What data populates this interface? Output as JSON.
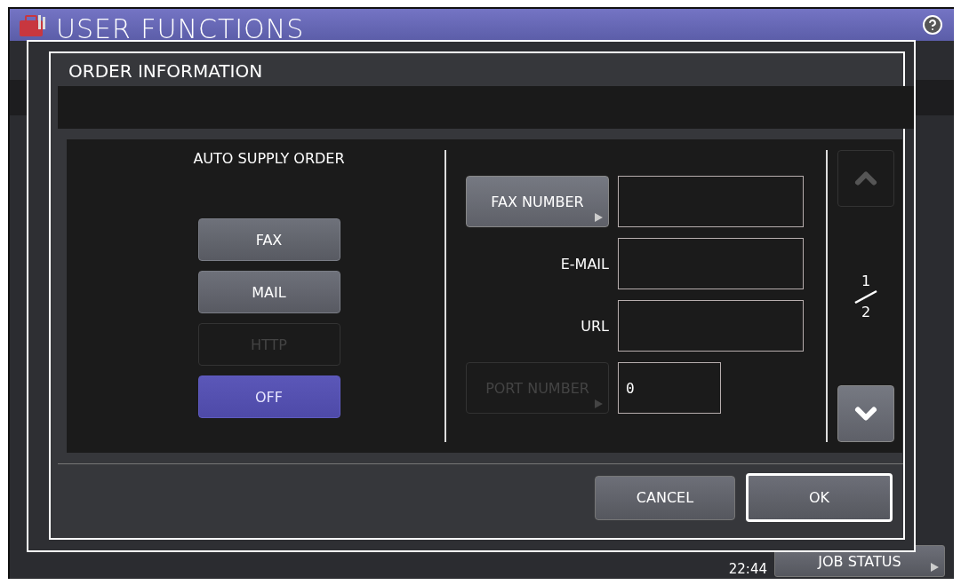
{
  "screen": {
    "title": "USER FUNCTIONS",
    "time": "22:44",
    "job_status_button": "JOB STATUS"
  },
  "dialog": {
    "title": "ORDER INFORMATION",
    "auto_supply_order": {
      "label": "AUTO SUPPLY ORDER",
      "options": [
        {
          "label": "FAX",
          "selected": false,
          "disabled": false
        },
        {
          "label": "MAIL",
          "selected": false,
          "disabled": false
        },
        {
          "label": "HTTP",
          "selected": false,
          "disabled": true
        },
        {
          "label": "OFF",
          "selected": true,
          "disabled": false
        }
      ]
    },
    "fields": [
      {
        "kind": "button",
        "label": "FAX NUMBER",
        "disabled": false,
        "short": false
      },
      {
        "kind": "label",
        "label": "E-MAIL",
        "short": false
      },
      {
        "kind": "label",
        "label": "URL",
        "short": false
      },
      {
        "kind": "button",
        "label": "PORT NUMBER",
        "disabled": true,
        "value": "0",
        "short": true
      }
    ],
    "pager": {
      "current": "1",
      "total": "2",
      "up_disabled": true,
      "down_disabled": false
    },
    "buttons": [
      {
        "label": "CANCEL",
        "focused": false
      },
      {
        "label": "OK",
        "focused": true
      }
    ]
  }
}
